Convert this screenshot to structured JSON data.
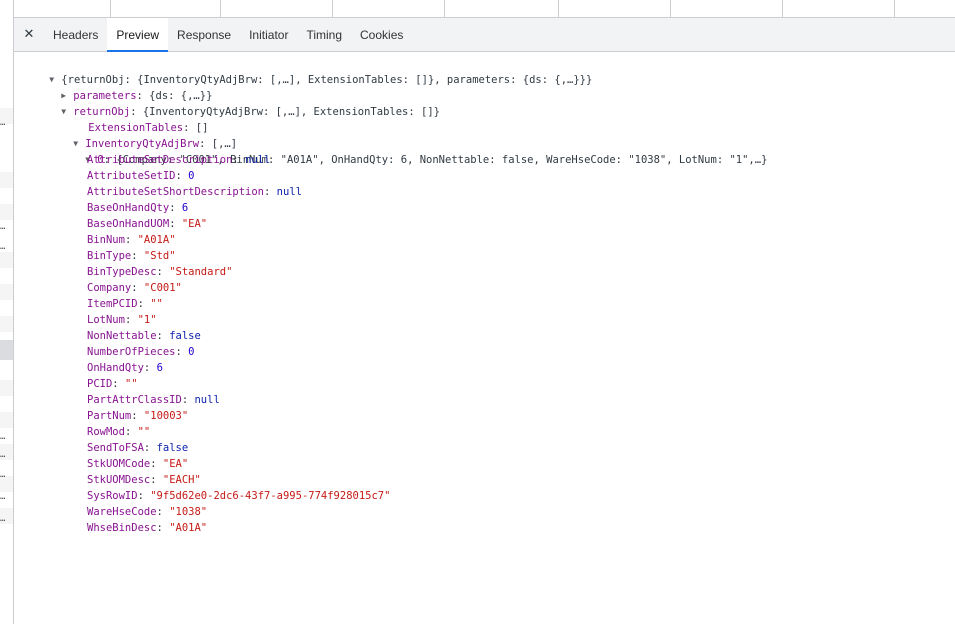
{
  "tabs": {
    "close_glyph": "✕",
    "items": [
      {
        "label": "Headers"
      },
      {
        "label": "Preview"
      },
      {
        "label": "Response"
      },
      {
        "label": "Initiator"
      },
      {
        "label": "Timing"
      },
      {
        "label": "Cookies"
      }
    ],
    "active": "Preview"
  },
  "left_strip_ellipsis": "…",
  "tree": {
    "root_summary": "{returnObj: {InventoryQtyAdjBrw: [,…], ExtensionTables: []}, parameters: {ds: {,…}}}",
    "parameters": {
      "key": "parameters",
      "summary": "{ds: {,…}}"
    },
    "returnObj": {
      "key": "returnObj",
      "summary": "{InventoryQtyAdjBrw: [,…], ExtensionTables: []}"
    },
    "extension_tables": {
      "key": "ExtensionTables",
      "value": "[]"
    },
    "inventory": {
      "key": "InventoryQtyAdjBrw",
      "summary": "[,…]"
    },
    "item0": {
      "key": "0",
      "summary": "{Company: \"C001\", BinNum: \"A01A\", OnHandQty: 6, NonNettable: false, WareHseCode: \"1038\", LotNum: \"1\",…}"
    },
    "fields": [
      {
        "key": "AttributeSetDescription",
        "value": "null",
        "type": "kw"
      },
      {
        "key": "AttributeSetID",
        "value": "0",
        "type": "num"
      },
      {
        "key": "AttributeSetShortDescription",
        "value": "null",
        "type": "kw"
      },
      {
        "key": "BaseOnHandQty",
        "value": "6",
        "type": "num"
      },
      {
        "key": "BaseOnHandUOM",
        "value": "\"EA\"",
        "type": "str"
      },
      {
        "key": "BinNum",
        "value": "\"A01A\"",
        "type": "str"
      },
      {
        "key": "BinType",
        "value": "\"Std\"",
        "type": "str"
      },
      {
        "key": "BinTypeDesc",
        "value": "\"Standard\"",
        "type": "str"
      },
      {
        "key": "Company",
        "value": "\"C001\"",
        "type": "str"
      },
      {
        "key": "ItemPCID",
        "value": "\"\"",
        "type": "str"
      },
      {
        "key": "LotNum",
        "value": "\"1\"",
        "type": "str"
      },
      {
        "key": "NonNettable",
        "value": "false",
        "type": "kw"
      },
      {
        "key": "NumberOfPieces",
        "value": "0",
        "type": "num"
      },
      {
        "key": "OnHandQty",
        "value": "6",
        "type": "num"
      },
      {
        "key": "PCID",
        "value": "\"\"",
        "type": "str"
      },
      {
        "key": "PartAttrClassID",
        "value": "null",
        "type": "kw"
      },
      {
        "key": "PartNum",
        "value": "\"10003\"",
        "type": "str"
      },
      {
        "key": "RowMod",
        "value": "\"\"",
        "type": "str"
      },
      {
        "key": "SendToFSA",
        "value": "false",
        "type": "kw"
      },
      {
        "key": "StkUOMCode",
        "value": "\"EA\"",
        "type": "str"
      },
      {
        "key": "StkUOMDesc",
        "value": "\"EACH\"",
        "type": "str"
      },
      {
        "key": "SysRowID",
        "value": "\"9f5d62e0-2dc6-43f7-a995-774f928015c7\"",
        "type": "str"
      },
      {
        "key": "WareHseCode",
        "value": "\"1038\"",
        "type": "str"
      },
      {
        "key": "WhseBinDesc",
        "value": "\"A01A\"",
        "type": "str"
      }
    ]
  }
}
